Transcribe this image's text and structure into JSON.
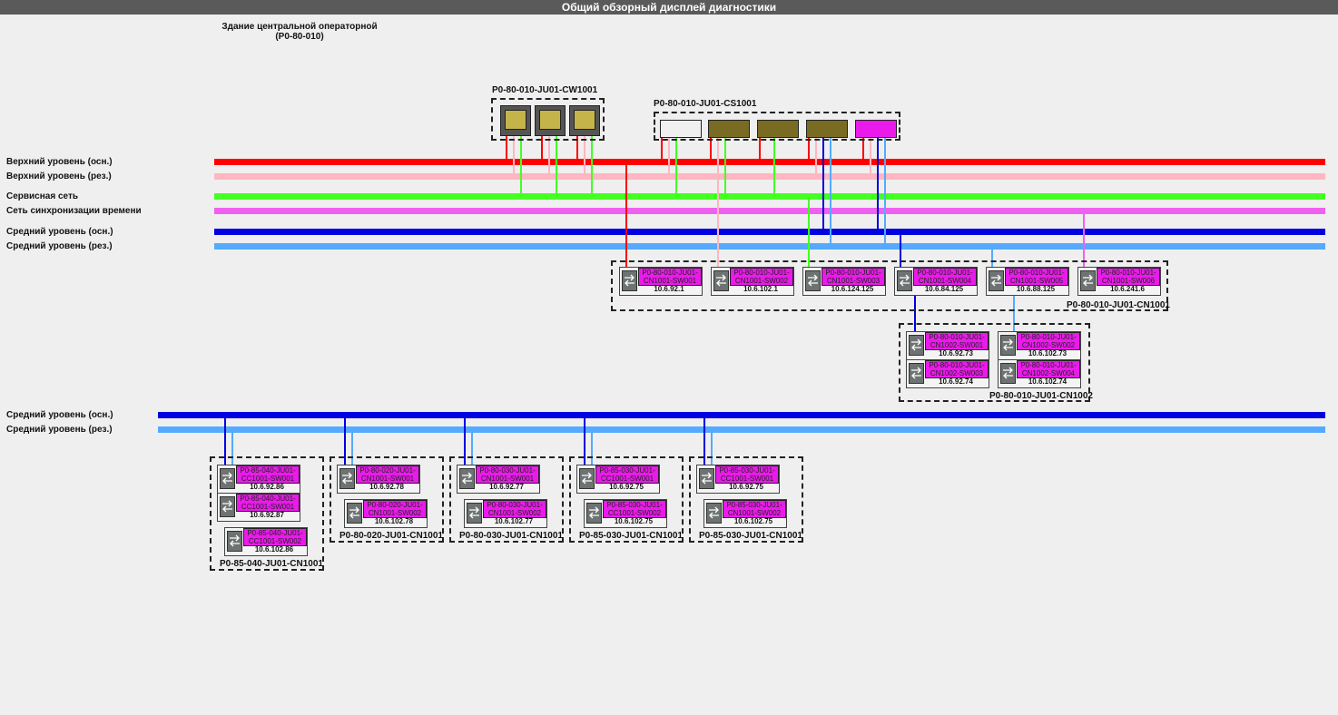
{
  "window": {
    "title": "Общий обзорный дисплей диагностики"
  },
  "building": {
    "line1": "Здание центральной операторной",
    "line2": "(P0-80-010)"
  },
  "colors": {
    "upper_main": "#ff0000",
    "upper_reserve": "#ffb6c1",
    "service": "#44ff22",
    "time_sync": "#f060f0",
    "middle_main": "#0000e0",
    "middle_reserve": "#55aaff",
    "switch_tag": "#ea1aea"
  },
  "networks": [
    {
      "name": "Верхний уровень (осн.)",
      "color_key": "upper_main"
    },
    {
      "name": "Верхний уровень (рез.)",
      "color_key": "upper_reserve"
    },
    {
      "name": "Сервисная сеть",
      "color_key": "service"
    },
    {
      "name": "Сеть синхронизации времени",
      "color_key": "time_sync"
    },
    {
      "name": "Средний уровень (осн.)",
      "color_key": "middle_main"
    },
    {
      "name": "Средний уровень (рез.)",
      "color_key": "middle_reserve"
    }
  ],
  "networks2": [
    {
      "name": "Средний уровень (осн.)",
      "color_key": "middle_main"
    },
    {
      "name": "Средний уровень (рез.)",
      "color_key": "middle_reserve"
    }
  ],
  "groups": {
    "cw1001": {
      "name": "P0-80-010-JU01-CW1001",
      "icon": "workstation-icon"
    },
    "cs1001": {
      "name": "P0-80-010-JU01-CS1001",
      "icon": "server-icon"
    },
    "cn1001": {
      "name": "P0-80-010-JU01-CN1001",
      "switches": [
        {
          "name": "P0-80-010-JU01-CN1001-SW001",
          "ip": "10.6.92.1"
        },
        {
          "name": "P0-80-010-JU01-CN1001-SW002",
          "ip": "10.6.102.1"
        },
        {
          "name": "P0-80-010-JU01-CN1001-SW003",
          "ip": "10.6.124.125"
        },
        {
          "name": "P0-80-010-JU01-CN1001-SW004",
          "ip": "10.6.84.125"
        },
        {
          "name": "P0-80-010-JU01-CN1001-SW005",
          "ip": "10.6.88.125"
        },
        {
          "name": "P0-80-010-JU01-CN1001-SW006",
          "ip": "10.6.241.6"
        }
      ]
    },
    "cn1002": {
      "name": "P0-80-010-JU01-CN1002",
      "switches": [
        {
          "name": "P0-80-010-JU01-CN1002-SW001",
          "ip": "10.6.92.73"
        },
        {
          "name": "P0-80-010-JU01-CN1002-SW002",
          "ip": "10.6.102.73"
        },
        {
          "name": "P0-80-010-JU01-CN1002-SW003",
          "ip": "10.6.92.74"
        },
        {
          "name": "P0-80-010-JU01-CN1002-SW004",
          "ip": "10.6.102.74"
        }
      ]
    },
    "s85040": {
      "name": "P0-85-040-JU01-CN1001",
      "switches": [
        {
          "name": "P0-85-040-JU01-CC1001-SW001",
          "ip": "10.6.92.86"
        },
        {
          "name": "P0-85-040-JU01-CC1001-SW001",
          "ip": "10.6.92.87"
        },
        {
          "name": "P0-85-040-JU01-CC1001-SW002",
          "ip": "10.6.102.86"
        }
      ]
    },
    "s80020": {
      "name": "P0-80-020-JU01-CN1001",
      "switches": [
        {
          "name": "P0-80-020-JU01-CN1001-SW001",
          "ip": "10.6.92.78"
        },
        {
          "name": "P0-80-020-JU01-CN1001-SW002",
          "ip": "10.6.102.78"
        }
      ]
    },
    "s80030": {
      "name": "P0-80-030-JU01-CN1001",
      "switches": [
        {
          "name": "P0-80-030-JU01-CN1001-SW001",
          "ip": "10.6.92.77"
        },
        {
          "name": "P0-80-030-JU01-CN1001-SW002",
          "ip": "10.6.102.77"
        }
      ]
    },
    "s85030a": {
      "name": "P0-85-030-JU01-CN1001",
      "switches": [
        {
          "name": "P0-85-030-JU01-CC1001-SW001",
          "ip": "10.6.92.75"
        },
        {
          "name": "P0-85-030-JU01-CC1001-SW002",
          "ip": "10.6.102.75"
        }
      ]
    },
    "s85030b": {
      "name": "P0-85-030-JU01-CN1001",
      "switches": [
        {
          "name": "P0-85-030-JU01-CC1001-SW001",
          "ip": "10.6.92.75"
        },
        {
          "name": "P0-85-030-JU01-CN1001-SW002",
          "ip": "10.6.102.75"
        }
      ]
    }
  }
}
